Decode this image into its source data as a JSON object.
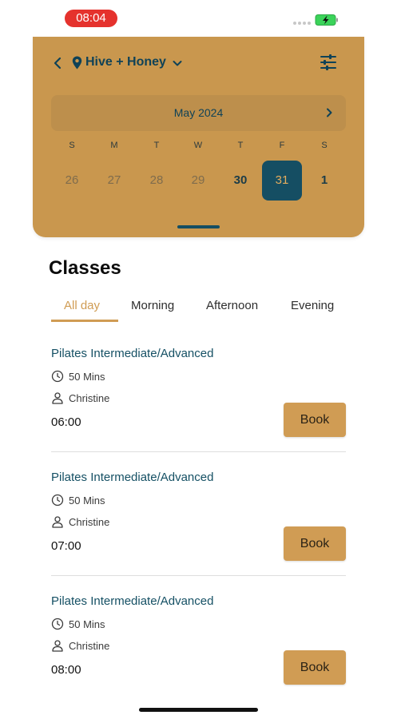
{
  "status_bar": {
    "time": "08:04"
  },
  "header": {
    "studio_name": "Hive + Honey",
    "icons": {
      "back": "chevron-left-icon",
      "location": "map-pin-icon",
      "studio_dropdown": "chevron-down-icon",
      "filter": "sliders-icon"
    }
  },
  "calendar": {
    "month_label": "May 2024",
    "weekdays": [
      "S",
      "M",
      "T",
      "W",
      "T",
      "F",
      "S"
    ],
    "days": [
      "26",
      "27",
      "28",
      "29",
      "30",
      "31",
      "1"
    ],
    "selected_day": "31"
  },
  "classes": {
    "title": "Classes",
    "tabs": [
      {
        "label": "All day",
        "active": true
      },
      {
        "label": "Morning",
        "active": false
      },
      {
        "label": "Afternoon",
        "active": false
      },
      {
        "label": "Evening",
        "active": false
      }
    ],
    "items": [
      {
        "name": "Pilates Intermediate/Advanced",
        "duration": "50 Mins",
        "instructor": "Christine",
        "time": "06:00",
        "book_label": "Book"
      },
      {
        "name": "Pilates Intermediate/Advanced",
        "duration": "50 Mins",
        "instructor": "Christine",
        "time": "07:00",
        "book_label": "Book"
      },
      {
        "name": "Pilates Intermediate/Advanced",
        "duration": "50 Mins",
        "instructor": "Christine",
        "time": "08:00",
        "book_label": "Book"
      }
    ]
  },
  "colors": {
    "accent": "#c9974e",
    "brand_dark": "#154e63",
    "book_button": "#d09c54",
    "status_time_pill": "#e5322d"
  }
}
